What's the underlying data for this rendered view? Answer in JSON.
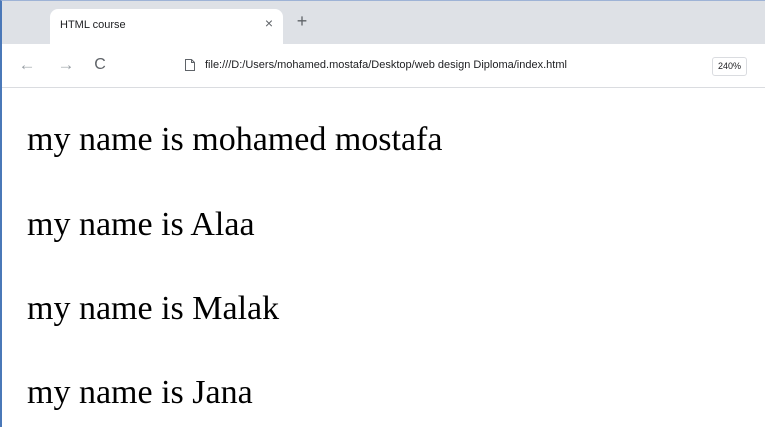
{
  "browser": {
    "tab": {
      "title": "HTML course",
      "close_glyph": "×"
    },
    "new_tab_glyph": "+",
    "nav": {
      "back_glyph": "←",
      "forward_glyph": "→",
      "reload_glyph": "C"
    },
    "omnibox": {
      "url": "file:///D:/Users/mohamed.mostafa/Desktop/web design Diploma/index.html",
      "icon": "page-icon",
      "zoom_level": "240%"
    }
  },
  "page": {
    "paragraphs": [
      "my name is mohamed mostafa",
      "my name is Alaa",
      "my name is Malak",
      "my name is Jana"
    ]
  },
  "colors": {
    "tabstrip_background": "#dee1e6",
    "window_border": "#4a78b8"
  }
}
